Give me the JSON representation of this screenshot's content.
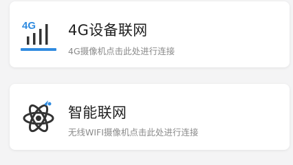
{
  "colors": {
    "accent": "#2f8be0",
    "icon_dark": "#333333",
    "title": "#1f1f1f",
    "subtitle": "#8a8a8a",
    "background": "#f4f4f5",
    "card": "#ffffff"
  },
  "options": [
    {
      "icon": "signal-4g-icon",
      "icon_text": "4G",
      "title": "4G设备联网",
      "subtitle": "4G摄像机点击此处进行连接"
    },
    {
      "icon": "atom-network-icon",
      "title": "智能联网",
      "subtitle": "无线WIFI摄像机点击此处进行连接"
    }
  ]
}
